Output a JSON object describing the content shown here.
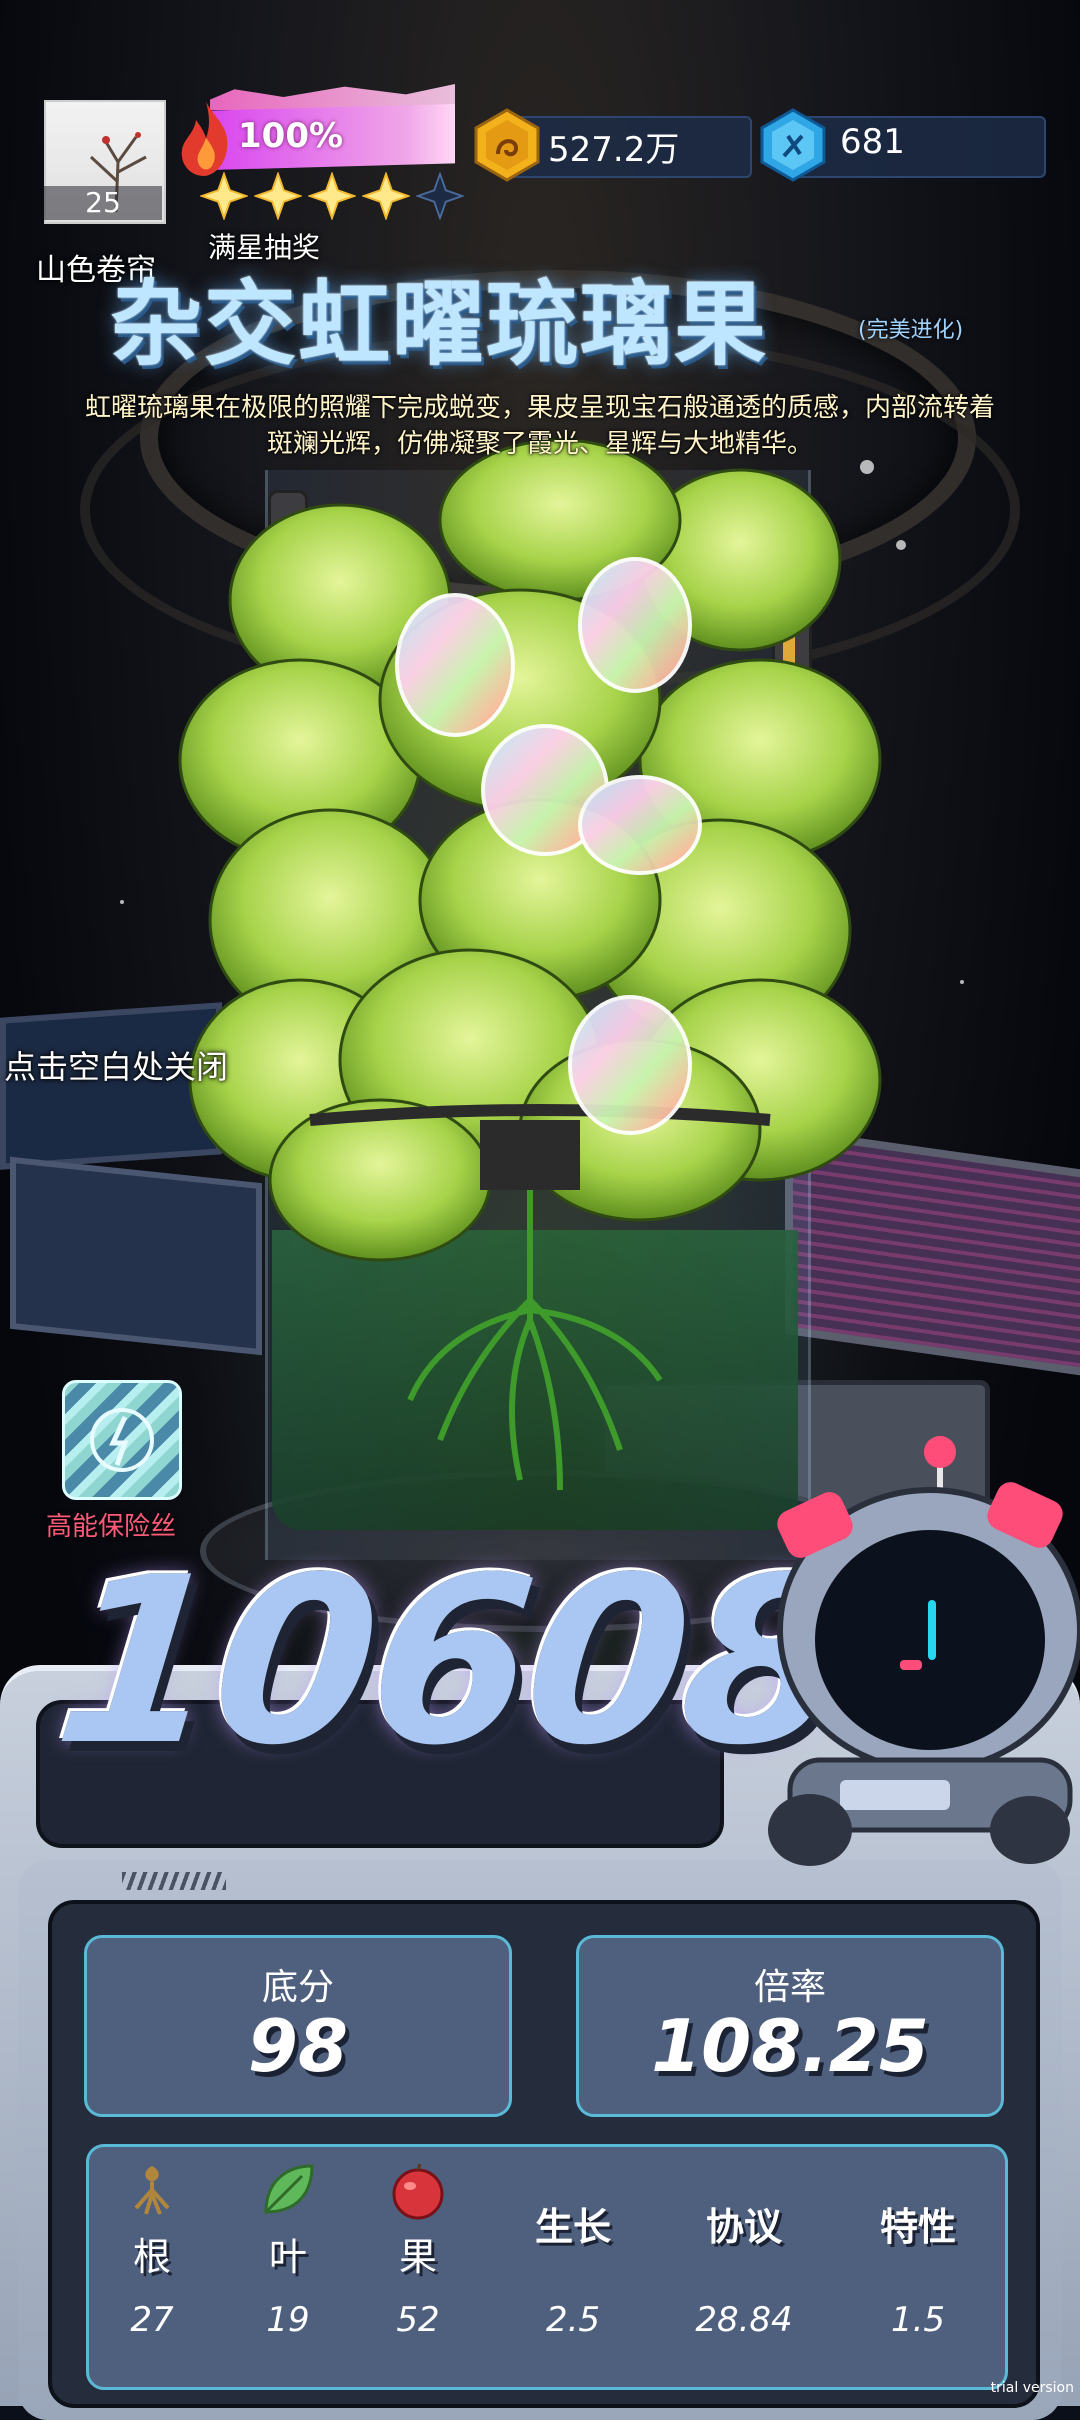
{
  "player": {
    "name": "山色卷帘",
    "level": "25"
  },
  "heat": {
    "percent_text": "100%",
    "stars_filled": 4,
    "stars_total": 5,
    "star_caption": "满星抽奖"
  },
  "currency": {
    "coins": "527.2万",
    "gems": "681"
  },
  "item": {
    "title": "杂交虹曜琉璃果",
    "tag": "(完美进化)",
    "description": "虹曜琉璃果在极限的照耀下完成蜕变，果皮呈现宝石般通透的质感，内部流转着斑斓光辉，仿佛凝聚了霞光、星辉与大地精华。"
  },
  "close_hint": "点击空白处关闭",
  "bonus_item": {
    "label": "高能保险丝"
  },
  "score": {
    "total": "10608"
  },
  "stats": {
    "base": {
      "label": "底分",
      "value": "98"
    },
    "multiplier": {
      "label": "倍率",
      "value": "108.25"
    }
  },
  "attributes": [
    {
      "name": "根",
      "value": "27",
      "icon": "root-icon"
    },
    {
      "name": "叶",
      "value": "19",
      "icon": "leaf-icon"
    },
    {
      "name": "果",
      "value": "52",
      "icon": "fruit-icon"
    },
    {
      "name": "生长",
      "value": "2.5"
    },
    {
      "name": "协议",
      "value": "28.84"
    },
    {
      "name": "特性",
      "value": "1.5"
    }
  ],
  "watermark": "trial version",
  "colors": {
    "accent": "#5bb9d8",
    "heat": "#d946ef",
    "coin": "#f3b21c",
    "gem": "#2fa7e6",
    "bonus_label": "#ff5a7a"
  }
}
